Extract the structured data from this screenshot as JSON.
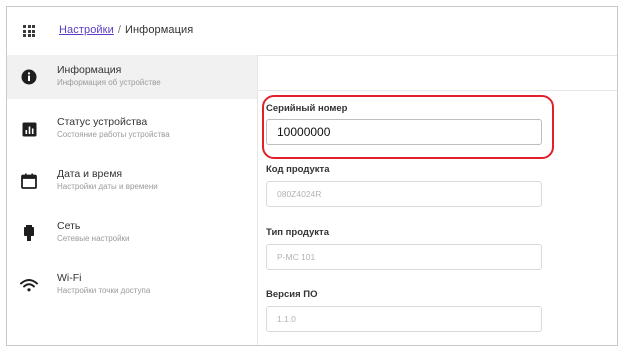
{
  "header": {
    "breadcrumb_link": "Настройки",
    "breadcrumb_separator": "/",
    "breadcrumb_current": "Информация",
    "apps_icon": "grid-icon"
  },
  "sidebar": {
    "items": [
      {
        "title": "Информация",
        "subtitle": "Информация об устройстве",
        "icon": "info-icon",
        "active": true
      },
      {
        "title": "Статус устройства",
        "subtitle": "Состояние работы устройства",
        "icon": "chart-icon",
        "active": false
      },
      {
        "title": "Дата и время",
        "subtitle": "Настройки даты и времени",
        "icon": "calendar-icon",
        "active": false
      },
      {
        "title": "Сеть",
        "subtitle": "Сетевые настройки",
        "icon": "ethernet-icon",
        "active": false
      },
      {
        "title": "Wi-Fi",
        "subtitle": "Настройки точки доступа",
        "icon": "wifi-icon",
        "active": false
      }
    ]
  },
  "form": {
    "serial": {
      "label": "Серийный номер",
      "value": "10000000"
    },
    "product_code": {
      "label": "Код продукта",
      "value": "080Z4024R"
    },
    "product_type": {
      "label": "Тип продукта",
      "value": "P-MC 101"
    },
    "firmware": {
      "label": "Версия ПО",
      "value": "1.1.0"
    }
  },
  "colors": {
    "link": "#5b3cc4",
    "highlight": "#e0202a",
    "active_bg": "#f1f1f1"
  }
}
